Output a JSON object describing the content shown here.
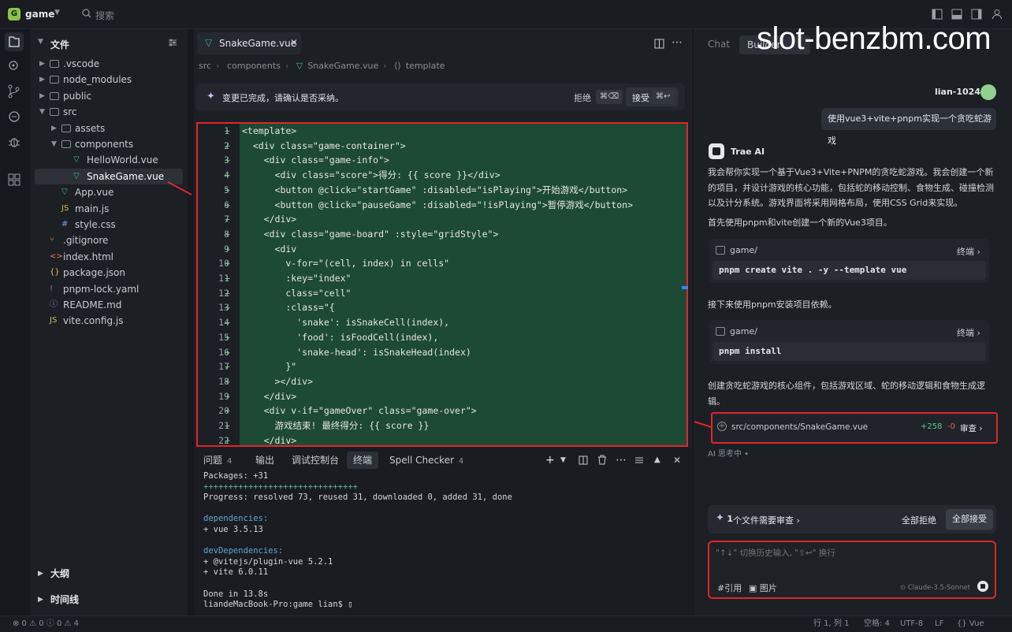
{
  "app": {
    "badge": "G",
    "title": "game",
    "search": "搜索"
  },
  "sidebar": {
    "title": "文件",
    "tree": [
      {
        "label": ".vscode",
        "kind": "folder",
        "depth": 0,
        "open": false
      },
      {
        "label": "node_modules",
        "kind": "folder",
        "depth": 0,
        "open": false
      },
      {
        "label": "public",
        "kind": "folder",
        "depth": 0,
        "open": false
      },
      {
        "label": "src",
        "kind": "folder",
        "depth": 0,
        "open": true
      },
      {
        "label": "assets",
        "kind": "folder",
        "depth": 1,
        "open": false
      },
      {
        "label": "components",
        "kind": "folder",
        "depth": 1,
        "open": true
      },
      {
        "label": "HelloWorld.vue",
        "kind": "vue",
        "depth": 2
      },
      {
        "label": "SnakeGame.vue",
        "kind": "vue",
        "depth": 2,
        "selected": true
      },
      {
        "label": "App.vue",
        "kind": "vue",
        "depth": 1
      },
      {
        "label": "main.js",
        "kind": "js",
        "depth": 1
      },
      {
        "label": "style.css",
        "kind": "css",
        "depth": 1
      },
      {
        "label": ".gitignore",
        "kind": "git",
        "depth": 0
      },
      {
        "label": "index.html",
        "kind": "html",
        "depth": 0
      },
      {
        "label": "package.json",
        "kind": "json",
        "depth": 0
      },
      {
        "label": "pnpm-lock.yaml",
        "kind": "yaml",
        "depth": 0
      },
      {
        "label": "README.md",
        "kind": "md",
        "depth": 0
      },
      {
        "label": "vite.config.js",
        "kind": "js",
        "depth": 0
      }
    ],
    "outline": "大纲",
    "timeline": "时间线"
  },
  "editor": {
    "tab": "SnakeGame.vue",
    "breadcrumb": [
      "src",
      "components",
      "SnakeGame.vue",
      "template"
    ],
    "notice": "变更已完成，请确认是否采纳。",
    "reject": "拒绝",
    "reject_key": "⌘⌫",
    "accept": "接受",
    "accept_key": "⌘↩",
    "lines": [
      "<template>",
      "  <div class=\"game-container\">",
      "    <div class=\"game-info\">",
      "      <div class=\"score\">得分: {{ score }}</div>",
      "      <button @click=\"startGame\" :disabled=\"isPlaying\">开始游戏</button>",
      "      <button @click=\"pauseGame\" :disabled=\"!isPlaying\">暂停游戏</button>",
      "    </div>",
      "    <div class=\"game-board\" :style=\"gridStyle\">",
      "      <div",
      "        v-for=\"(cell, index) in cells\"",
      "        :key=\"index\"",
      "        class=\"cell\"",
      "        :class=\"{",
      "          'snake': isSnakeCell(index),",
      "          'food': isFoodCell(index),",
      "          'snake-head': isSnakeHead(index)",
      "        }\"",
      "      ></div>",
      "    </div>",
      "    <div v-if=\"gameOver\" class=\"game-over\">",
      "      游戏结束! 最终得分: {{ score }}",
      "    </div>"
    ]
  },
  "panel": {
    "tabs": [
      {
        "label": "问题",
        "count": "4"
      },
      {
        "label": "输出"
      },
      {
        "label": "调试控制台"
      },
      {
        "label": "终端",
        "active": true
      },
      {
        "label": "Spell Checker",
        "count": "4"
      }
    ],
    "terminal": [
      "Packages: +31",
      "+++++++++++++++++++++++++++++++",
      "Progress: resolved 73, reused 31, downloaded 0, added 31, done",
      "",
      "dependencies:",
      "+ vue 3.5.13",
      "",
      "devDependencies:",
      "+ @vitejs/plugin-vue 5.2.1",
      "+ vite 6.0.11",
      "",
      "Done in 13.8s",
      "liandeMacBook-Pro:game lian$ ▯"
    ]
  },
  "chat": {
    "tab_chat": "Chat",
    "tab_builder": "Builder",
    "watermark": "slot-benzbm.com",
    "user_name": "lian-1024",
    "user_msg": "使用vue3+vite+pnpm实现一个贪吃蛇游戏",
    "ai_name": "Trae AI",
    "para1": "我会帮你实现一个基于Vue3+Vite+PNPM的贪吃蛇游戏。我会创建一个新的项目，并设计游戏的核心功能，包括蛇的移动控制、食物生成、碰撞检测以及计分系统。游戏界面将采用网格布局，使用CSS Grid来实现。",
    "para2": "首先使用pnpm和vite创建一个新的Vue3项目。",
    "cmd1": {
      "path": "game/",
      "terminal": "终端",
      "code": "pnpm create vite . -y --template vue"
    },
    "para3": "接下来使用pnpm安装项目依赖。",
    "cmd2": {
      "path": "game/",
      "terminal": "终端",
      "code": "pnpm install"
    },
    "para4": "创建贪吃蛇游戏的核心组件，包括游戏区域、蛇的移动逻辑和食物生成逻辑。",
    "file": {
      "path": "src/components/SnakeGame.vue",
      "added": "+258",
      "removed": "-0",
      "review": "审查"
    },
    "thinking": "AI 思考中",
    "review_count": "1",
    "review_text": "个文件需要审查",
    "reject_all": "全部拒绝",
    "accept_all": "全部接受",
    "input_placeholder": "\"↑↓\" 切换历史输入, \"⇧↩\" 换行",
    "ref": "#引用",
    "image": "图片",
    "model": "Claude-3.5-Sonnet"
  },
  "status": {
    "left": "0 0 0 4",
    "position": "行 1, 列 1",
    "spaces": "空格: 4",
    "encoding": "UTF-8",
    "eol": "LF",
    "lang": "Vue"
  },
  "colors": {
    "accent_red": "#e0262c",
    "vue_green": "#42b883",
    "added_bg": "#1d4a34"
  }
}
